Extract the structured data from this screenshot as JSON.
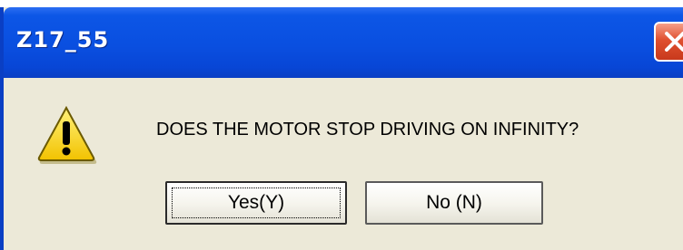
{
  "window": {
    "title": "Z17_55",
    "message": "DOES THE MOTOR STOP DRIVING ON INFINITY?"
  },
  "buttons": {
    "yes_label": "Yes(Y)",
    "no_label": "No (N)"
  },
  "icons": {
    "dialog_icon": "warning-icon",
    "close_icon": "close-icon"
  },
  "colors": {
    "titlebar": "#0a4fe0",
    "close_button": "#d9532f",
    "dialog_background": "#ece9d8",
    "warning_yellow": "#ffdd33"
  }
}
